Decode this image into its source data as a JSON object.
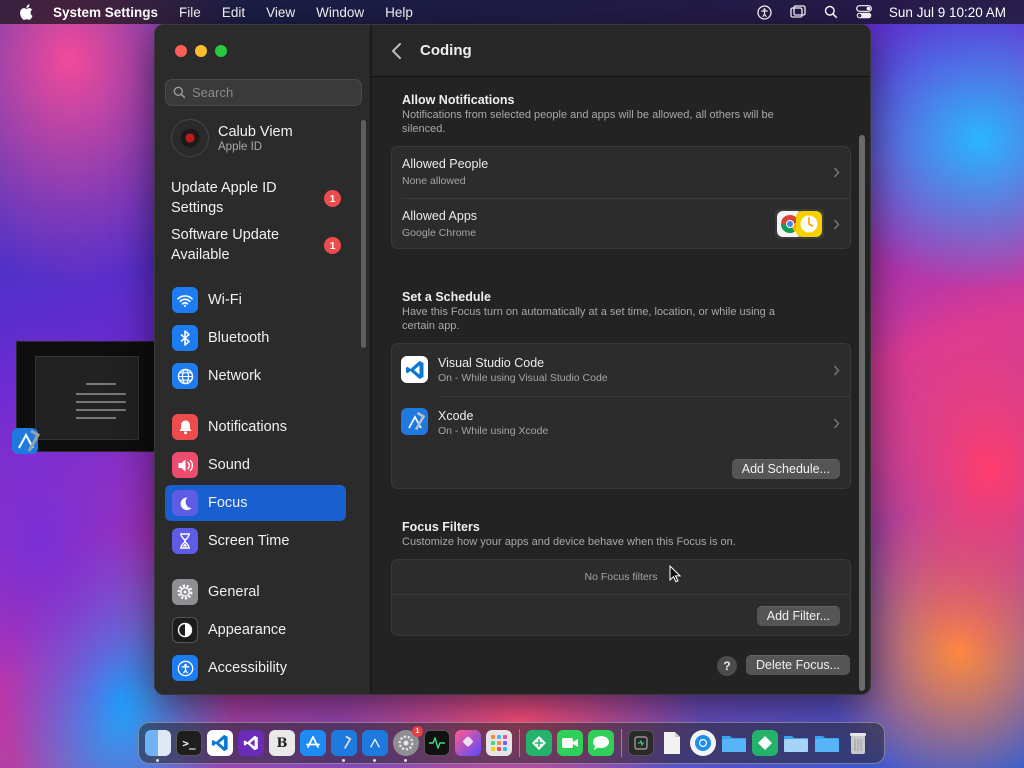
{
  "menubar": {
    "apple_icon": "apple-logo-icon",
    "app_name": "System Settings",
    "menus": [
      "File",
      "Edit",
      "View",
      "Window",
      "Help"
    ],
    "status_icons": [
      "accessibility-icon",
      "screen-mirroring-icon",
      "spotlight-search-icon",
      "control-center-icon"
    ],
    "clock": "Sun Jul 9  10:20 AM"
  },
  "sidebar": {
    "search_placeholder": "Search",
    "profile": {
      "name": "Calub Viem",
      "subtitle": "Apple ID"
    },
    "alerts": [
      {
        "label": "Update Apple ID Settings",
        "badge": "1"
      },
      {
        "label": "Software Update Available",
        "badge": "1"
      }
    ],
    "items": [
      {
        "label": "Wi-Fi",
        "icon": "wifi-icon",
        "color": "#1d7cf2"
      },
      {
        "label": "Bluetooth",
        "icon": "bluetooth-icon",
        "color": "#1d7cf2"
      },
      {
        "label": "Network",
        "icon": "globe-icon",
        "color": "#1d7cf2"
      },
      {
        "label": "Notifications",
        "icon": "bell-icon",
        "color": "#ec4c4c"
      },
      {
        "label": "Sound",
        "icon": "speaker-icon",
        "color": "#ec4c6e"
      },
      {
        "label": "Focus",
        "icon": "moon-icon",
        "color": "#5e5ce6",
        "active": true
      },
      {
        "label": "Screen Time",
        "icon": "hourglass-icon",
        "color": "#5e5ce6"
      },
      {
        "label": "General",
        "icon": "gear-icon",
        "color": "#8e8e93"
      },
      {
        "label": "Appearance",
        "icon": "appearance-icon",
        "color": "#1c1c1e"
      },
      {
        "label": "Accessibility",
        "icon": "accessibility-icon",
        "color": "#1d7cf2"
      }
    ]
  },
  "content": {
    "title": "Coding",
    "allow_notifications": {
      "heading": "Allow Notifications",
      "description": "Notifications from selected people and apps will be allowed, all others will be silenced.",
      "rows": [
        {
          "title": "Allowed People",
          "subtitle": "None allowed"
        },
        {
          "title": "Allowed Apps",
          "subtitle": "Google Chrome",
          "icons": [
            "chrome-icon",
            "clock-app-icon"
          ]
        }
      ]
    },
    "schedule": {
      "heading": "Set a Schedule",
      "description": "Have this Focus turn on automatically at a set time, location, or while using a certain app.",
      "rows": [
        {
          "title": "Visual Studio Code",
          "subtitle": "On - While using Visual Studio Code",
          "icon": "vscode-icon"
        },
        {
          "title": "Xcode",
          "subtitle": "On - While using Xcode",
          "icon": "xcode-icon"
        }
      ],
      "add_button": "Add Schedule..."
    },
    "filters": {
      "heading": "Focus Filters",
      "description": "Customize how your apps and device behave when this Focus is on.",
      "empty_text": "No Focus filters",
      "add_button": "Add Filter..."
    },
    "help_label": "?",
    "delete_button": "Delete Focus..."
  },
  "dock": {
    "badge_settings": "1",
    "apps": [
      "finder-icon",
      "terminal-icon",
      "vscode-icon",
      "visual-studio-icon",
      "bbedit-icon",
      "app-store-icon",
      "xcode-icon",
      "xcode-alt-icon",
      "system-settings-icon",
      "activity-monitor-icon",
      "shortcuts-icon",
      "launchpad-icon",
      "kite-icon",
      "facetime-icon",
      "messages-icon",
      "console-icon",
      "document-icon",
      "chrome-icon",
      "folder-icon",
      "kite-folder-icon",
      "downloads-folder-icon",
      "folder-icon-2",
      "trash-icon"
    ]
  }
}
